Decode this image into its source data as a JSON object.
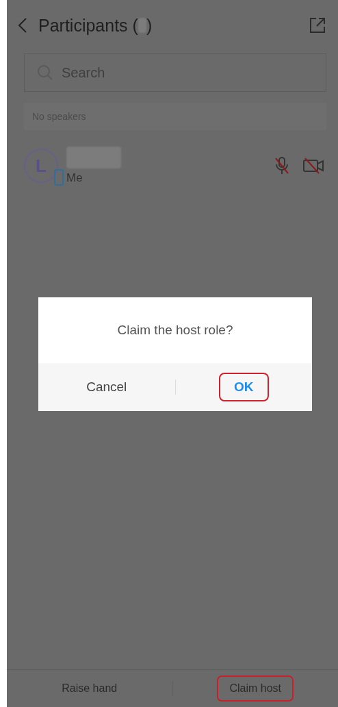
{
  "header": {
    "title": "Participants (",
    "title_end": ")"
  },
  "search": {
    "placeholder": "Search"
  },
  "speakers": {
    "text": "No speakers"
  },
  "participants": [
    {
      "initial": "L",
      "label": "Me",
      "muted": true,
      "video_off": true
    }
  ],
  "dialog": {
    "message": "Claim the host role?",
    "buttons": [
      {
        "label": "Cancel",
        "kind": "plain",
        "highlighted": false
      },
      {
        "label": "OK",
        "kind": "primary",
        "highlighted": true
      }
    ]
  },
  "bottom_bar": [
    {
      "label": "Raise hand",
      "highlighted": false
    },
    {
      "label": "Claim host",
      "highlighted": true
    }
  ]
}
